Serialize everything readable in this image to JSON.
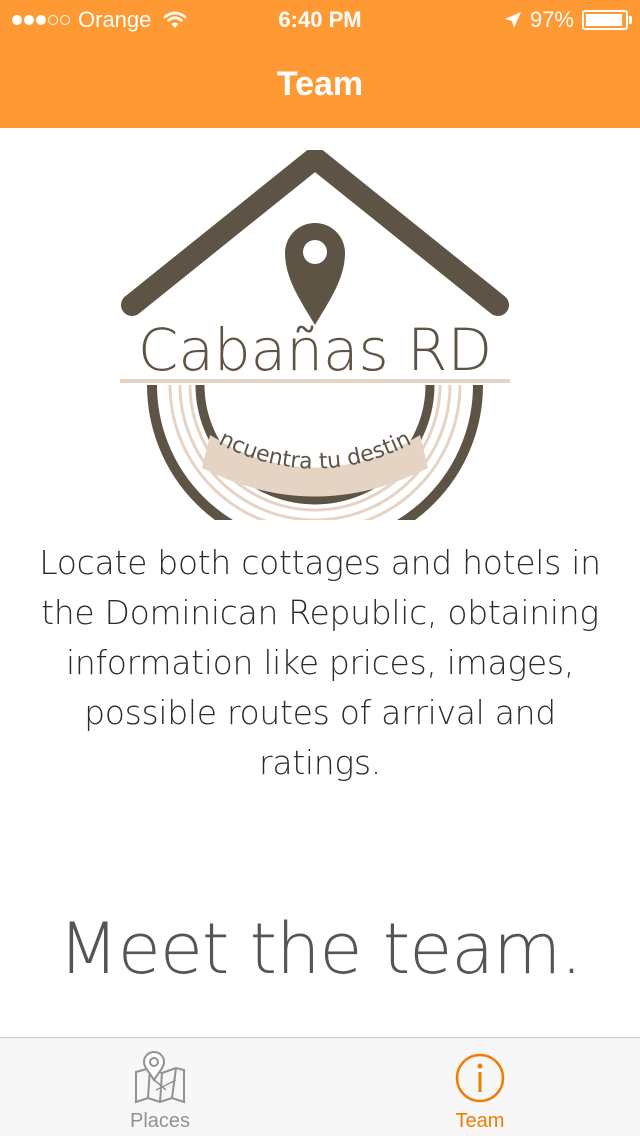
{
  "status_bar": {
    "carrier": "Orange",
    "time": "6:40 PM",
    "battery": "97%",
    "signal_bars_filled": 3,
    "signal_bars_total": 5
  },
  "nav": {
    "title": "Team"
  },
  "logo": {
    "name": "Cabañas RD",
    "tagline": "encuentra tu destino"
  },
  "main": {
    "description": "Locate both cottages and hotels in the Dominican Republic, obtaining information like prices, images, possible routes of arrival and ratings.",
    "meet_heading": "Meet the team."
  },
  "tabs": [
    {
      "label": "Places",
      "icon": "map-pin-icon",
      "selected": false
    },
    {
      "label": "Team",
      "icon": "info-icon",
      "selected": true
    }
  ],
  "colors": {
    "accent": "#FF9933",
    "tab_selected": "#F07D00",
    "tab_unselected": "#929292",
    "logo_brown": "#5E5446",
    "logo_beige": "#E5D3C3"
  }
}
